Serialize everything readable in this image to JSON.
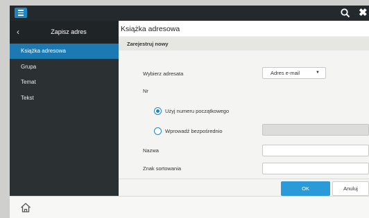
{
  "colors": {
    "topbar": "#23292c",
    "sidebar": "#2b3133",
    "accent": "#1f86c6",
    "ok_button": "#2a9ad8"
  },
  "topbar": {
    "menu_icon": "hamburger-menu-icon",
    "search_icon": "search-icon",
    "close_icon": "close-icon",
    "close_glyph": "✖"
  },
  "sidebar": {
    "back_glyph": "‹",
    "title": "Zapisz adres",
    "items": [
      {
        "label": "Książka adresowa",
        "active": true
      },
      {
        "label": "Grupa",
        "active": false
      },
      {
        "label": "Temat",
        "active": false
      },
      {
        "label": "Tekst",
        "active": false
      }
    ]
  },
  "main": {
    "title": "Książka adresowa",
    "section": "Zarejestruj nowy",
    "select_recipient": {
      "label": "Wybierz adresata",
      "value": "Adres e-mail",
      "caret": "▼"
    },
    "number": {
      "label": "Nr",
      "options": [
        {
          "label": "Użyj numeru początkowego",
          "selected": true
        },
        {
          "label": "Wprowadź bezpośrednio",
          "selected": false
        }
      ],
      "direct_value": ""
    },
    "name": {
      "label": "Nazwa",
      "value": ""
    },
    "sort_key": {
      "label": "Znak sortowania",
      "value": ""
    }
  },
  "footer": {
    "ok": "OK",
    "cancel": "Anuluj"
  },
  "bottombar": {
    "home_icon": "home-icon"
  }
}
